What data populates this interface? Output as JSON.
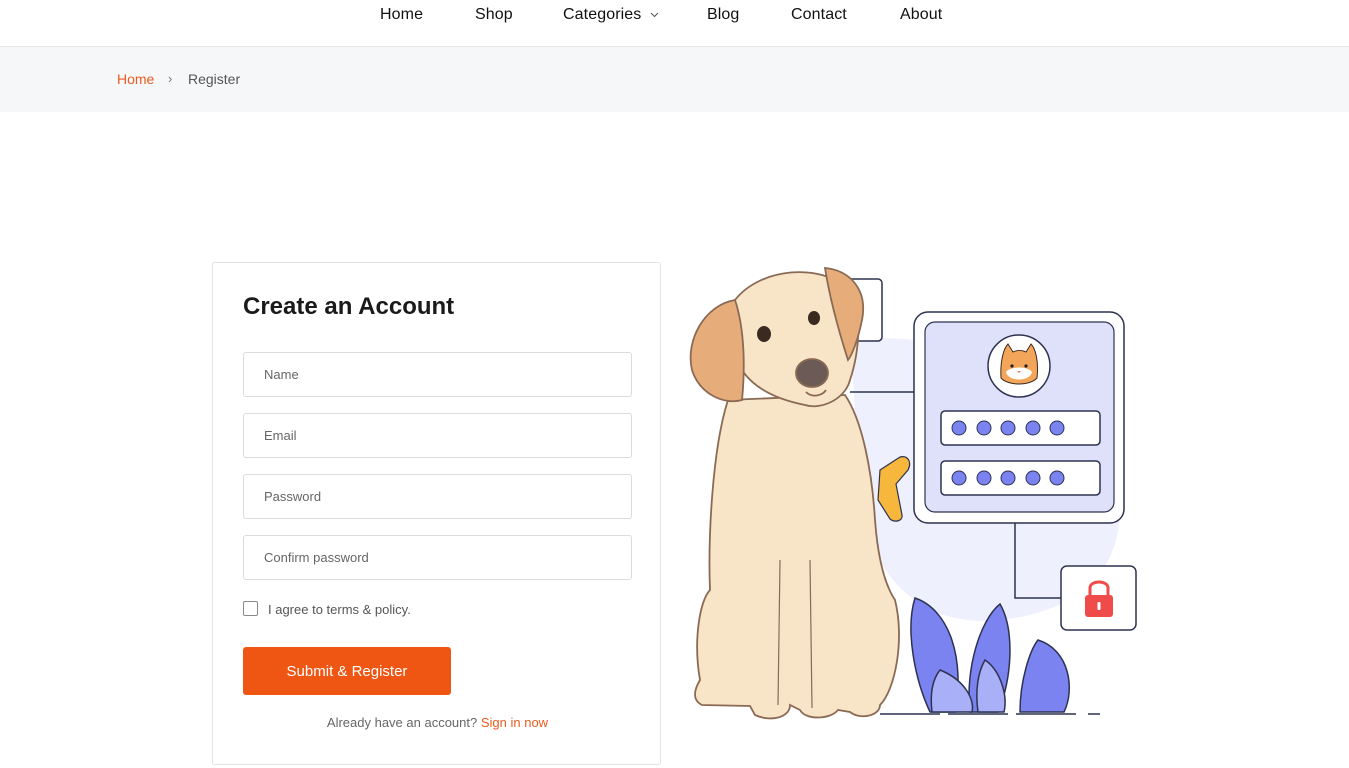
{
  "nav": {
    "items": [
      {
        "label": "Home"
      },
      {
        "label": "Shop"
      },
      {
        "label": "Categories"
      },
      {
        "label": "Blog"
      },
      {
        "label": "Contact"
      },
      {
        "label": "About"
      }
    ]
  },
  "breadcrumb": {
    "home": "Home",
    "separator": "›",
    "current": "Register"
  },
  "form": {
    "title": "Create an Account",
    "name_placeholder": "Name",
    "email_placeholder": "Email",
    "password_placeholder": "Password",
    "confirm_placeholder": "Confirm password",
    "agree_label": "I agree to terms & policy.",
    "agree_checked": false,
    "submit_label": "Submit & Register",
    "signin_prompt": "Already have an account?",
    "signin_link": "Sign in now"
  },
  "colors": {
    "accent": "#ef5613",
    "link": "#ea5b1f",
    "breadcrumb_bg": "#f6f7f9",
    "illustration_primary": "#7b83f0"
  },
  "icons": {
    "categories_dropdown": "chevron-down-icon",
    "illustration_lock": "lock-icon",
    "illustration_avatar": "cat-avatar-icon"
  }
}
